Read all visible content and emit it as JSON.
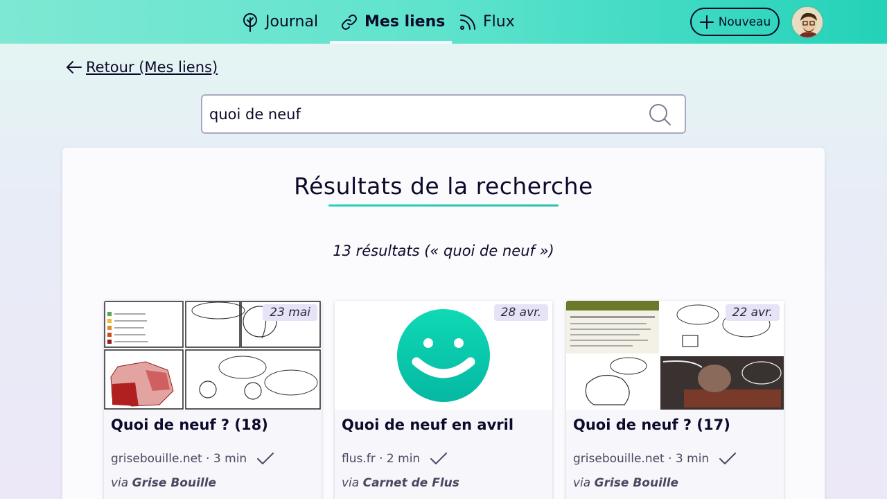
{
  "nav": {
    "journal": "Journal",
    "liens": "Mes liens",
    "flux": "Flux",
    "new_button": "Nouveau"
  },
  "back_link": "Retour (Mes liens)",
  "search": {
    "value": "quoi de neuf"
  },
  "panel": {
    "title": "Résultats de la recherche",
    "count": "13 résultats (« quoi de neuf »)"
  },
  "cards": [
    {
      "date": "23 mai",
      "title": "Quoi de neuf ? (18)",
      "meta": "grisebouille.net · 3 min",
      "via_prefix": "via",
      "via": "Grise Bouille"
    },
    {
      "date": "28 avr.",
      "title": "Quoi de neuf en avril",
      "meta": "flus.fr · 2 min",
      "via_prefix": "via",
      "via": "Carnet de Flus"
    },
    {
      "date": "22 avr.",
      "title": "Quoi de neuf ? (17)",
      "meta": "grisebouille.net · 3 min",
      "via_prefix": "via",
      "via": "Grise Bouille"
    }
  ],
  "colors": {
    "header_start": "#7ee8d3",
    "header_end": "#23d2b8",
    "accent": "#23d2b8",
    "text": "#0c0a2a"
  }
}
